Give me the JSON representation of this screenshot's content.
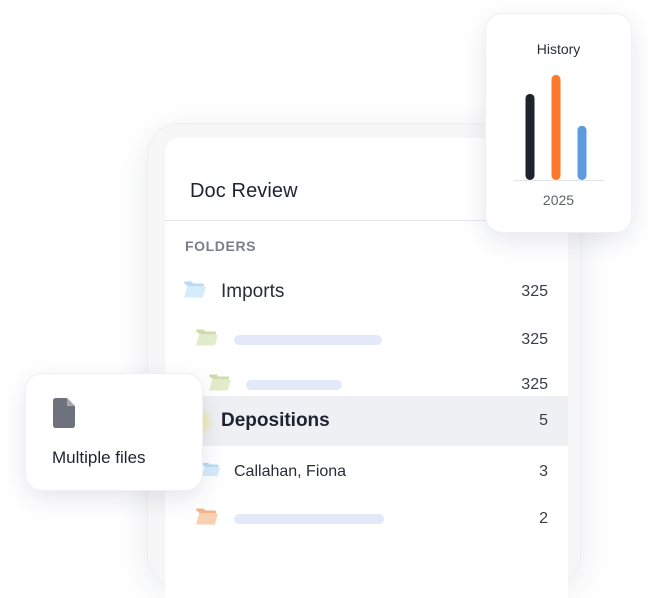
{
  "panel": {
    "title": "Doc Review",
    "section_label": "FOLDERS",
    "rows": [
      {
        "label": "Imports",
        "count": "325"
      },
      {
        "label": "",
        "count": "325"
      },
      {
        "label": "",
        "count": "325"
      },
      {
        "label": "Depositions",
        "count": "5"
      },
      {
        "label": "Callahan, Fiona",
        "count": "3"
      },
      {
        "label": "",
        "count": "2"
      }
    ]
  },
  "colors": {
    "folder_blue": "#cfe6f8",
    "folder_green": "#dde6c6",
    "folder_orange": "#f6c9a8",
    "placeholder_bar": "#e3e9f8",
    "series_dark": "#1e232d",
    "series_orange": "#fc7a2a",
    "series_blue": "#5d9be0"
  },
  "icons": {
    "folder": "folder-open-icon",
    "document": "document-icon"
  },
  "history": {
    "title": "History",
    "year": "2025"
  },
  "chart_data": {
    "type": "bar",
    "categories": [
      "2025"
    ],
    "series": [
      {
        "values": [
          100
        ]
      },
      {
        "values": [
          122
        ]
      },
      {
        "values": [
          63
        ]
      }
    ],
    "ylim": [
      0,
      130
    ]
  },
  "multiple_files": {
    "label": "Multiple files"
  }
}
